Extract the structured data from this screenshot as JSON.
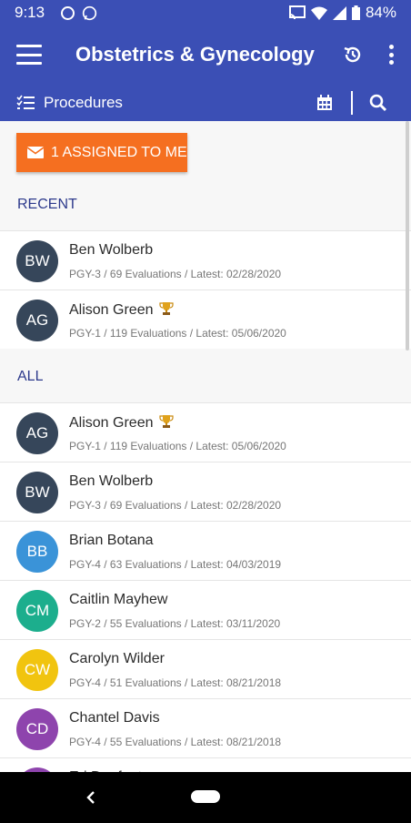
{
  "status": {
    "time": "9:13",
    "battery": "84%"
  },
  "header": {
    "title": "Obstetrics & Gynecology",
    "subtitle": "Procedures"
  },
  "assign_button": {
    "label": "1 ASSIGNED TO ME"
  },
  "sections": {
    "recent": "RECENT",
    "all": "ALL"
  },
  "recent": [
    {
      "initials": "BW",
      "name": "Ben Wolberb",
      "trophy": false,
      "details": "PGY-3 / 69 Evaluations / Latest: 02/28/2020",
      "color": "#36465a"
    },
    {
      "initials": "AG",
      "name": "Alison Green",
      "trophy": true,
      "details": "PGY-1 / 119 Evaluations / Latest: 05/06/2020",
      "color": "#36465a"
    }
  ],
  "all": [
    {
      "initials": "AG",
      "name": "Alison Green",
      "trophy": true,
      "details": "PGY-1 / 119 Evaluations / Latest: 05/06/2020",
      "color": "#36465a"
    },
    {
      "initials": "BW",
      "name": "Ben Wolberb",
      "trophy": false,
      "details": "PGY-3 / 69 Evaluations / Latest: 02/28/2020",
      "color": "#36465a"
    },
    {
      "initials": "BB",
      "name": "Brian Botana",
      "trophy": false,
      "details": "PGY-4 / 63 Evaluations / Latest: 04/03/2019",
      "color": "#3a93d8"
    },
    {
      "initials": "CM",
      "name": "Caitlin Mayhew",
      "trophy": false,
      "details": "PGY-2 / 55 Evaluations / Latest: 03/11/2020",
      "color": "#1cae8d"
    },
    {
      "initials": "CW",
      "name": "Carolyn Wilder",
      "trophy": false,
      "details": "PGY-4 / 51 Evaluations / Latest: 08/21/2018",
      "color": "#f1c40f"
    },
    {
      "initials": "CD",
      "name": "Chantel Davis",
      "trophy": false,
      "details": "PGY-4 / 55 Evaluations / Latest: 08/21/2018",
      "color": "#8e44ad"
    },
    {
      "initials": "",
      "name": "Eri Danfeet",
      "trophy": false,
      "details": "",
      "color": "#8e44ad"
    }
  ],
  "colors": {
    "primary": "#3b4fb5",
    "accent": "#f56f20",
    "section_text": "#2d3a8c"
  },
  "icons": [
    "menu-icon",
    "history-icon",
    "more-vert-icon",
    "checklist-icon",
    "calendar-icon",
    "search-icon",
    "mail-icon",
    "trophy-icon",
    "back-icon",
    "home-icon"
  ]
}
